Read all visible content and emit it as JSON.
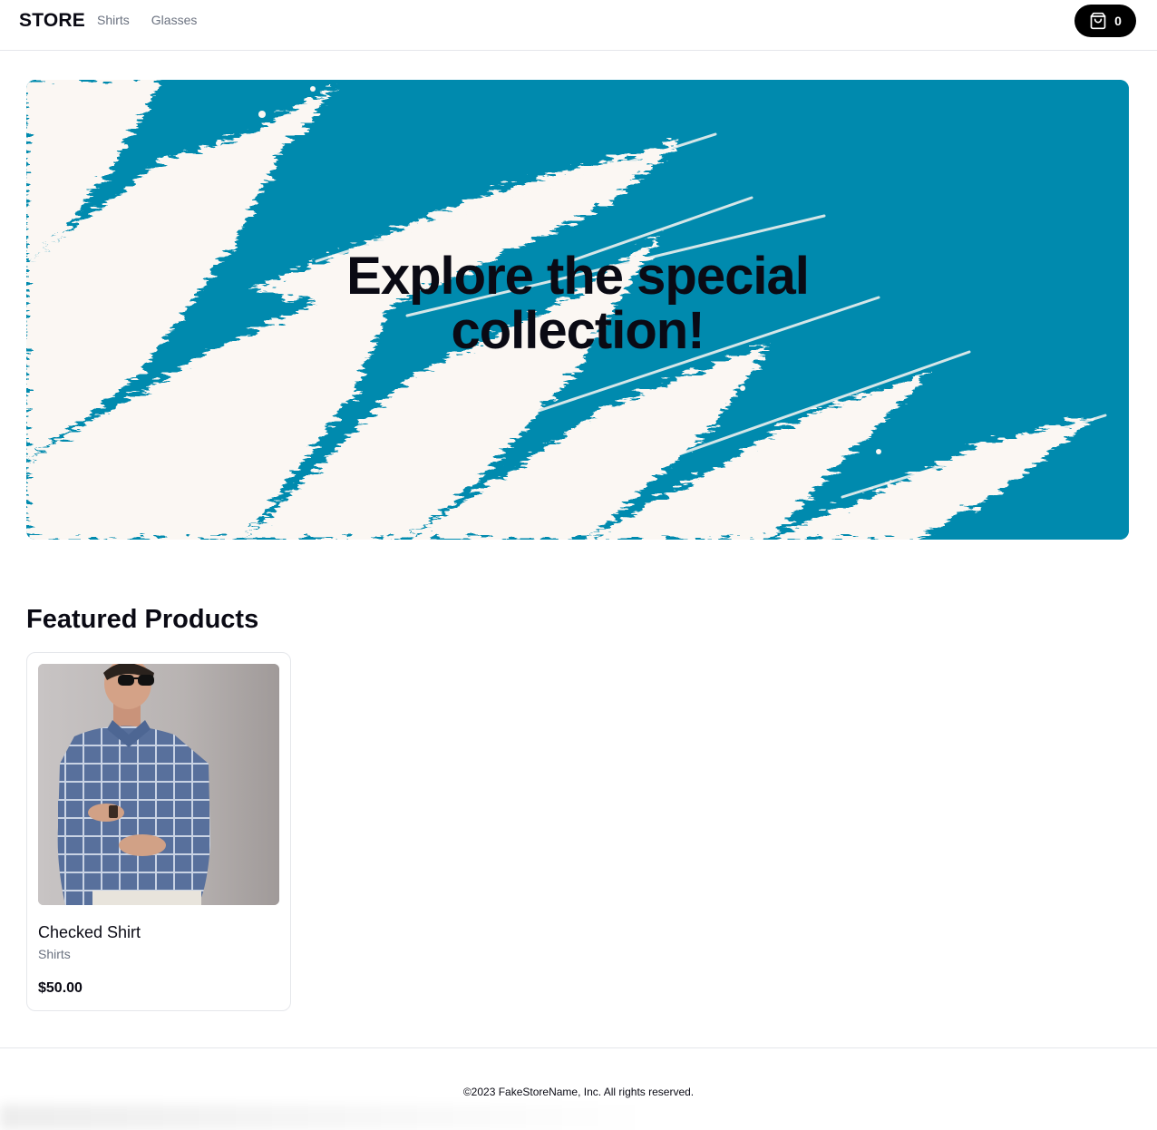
{
  "header": {
    "logo": "STORE",
    "nav": [
      {
        "label": "Shirts"
      },
      {
        "label": "Glasses"
      }
    ],
    "cart": {
      "icon": "shopping-bag-icon",
      "count": "0"
    }
  },
  "hero": {
    "title": "Explore the special collection!",
    "colors": {
      "background": "#008aae",
      "paint": "#fbf7f3"
    }
  },
  "featured": {
    "title": "Featured Products",
    "products": [
      {
        "name": "Checked Shirt",
        "category": "Shirts",
        "price": "$50.00"
      }
    ]
  },
  "footer": {
    "text": "©2023 FakeStoreName, Inc. All rights reserved."
  }
}
